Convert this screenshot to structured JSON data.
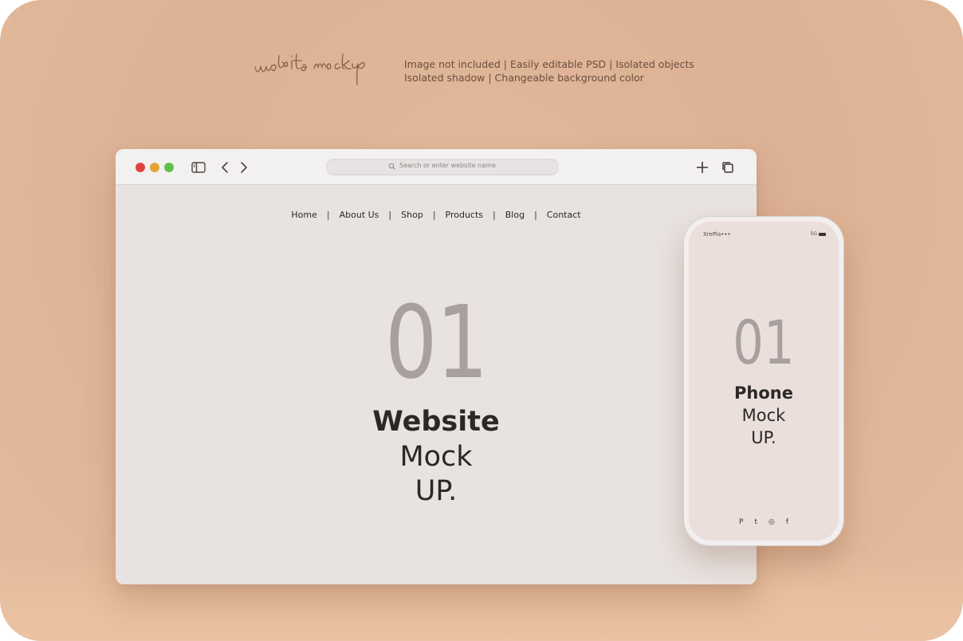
{
  "header": {
    "brand_script": "website mockup",
    "features_line1": "Image not included  |  Easily editable PSD  |  Isolated objects",
    "features_line2": "Isolated shadow  |  Changeable background color"
  },
  "browser": {
    "search_placeholder": "Search or enter website name",
    "nav": [
      "Home",
      "About Us",
      "Shop",
      "Products",
      "Blog",
      "Contact"
    ],
    "separator": "|",
    "hero_number": "01",
    "hero_bold": "Website",
    "hero_line2": "Mock",
    "hero_line3": "UP."
  },
  "phone": {
    "status_left": "XrePla•••",
    "status_right": "5G",
    "hero_number": "01",
    "hero_bold": "Phone",
    "hero_line2": "Mock",
    "hero_line3": "UP.",
    "socials": [
      "P",
      "t",
      "◎",
      "f"
    ]
  },
  "colors": {
    "background": "#ddb194",
    "browser_body": "#e8e2e0",
    "phone_screen": "#ebdfdc",
    "number_gray": "#a7a09f",
    "dark_text": "#2b2828",
    "traffic_red": "#e0443e",
    "traffic_yellow": "#e6a33a",
    "traffic_green": "#5fc14a"
  }
}
